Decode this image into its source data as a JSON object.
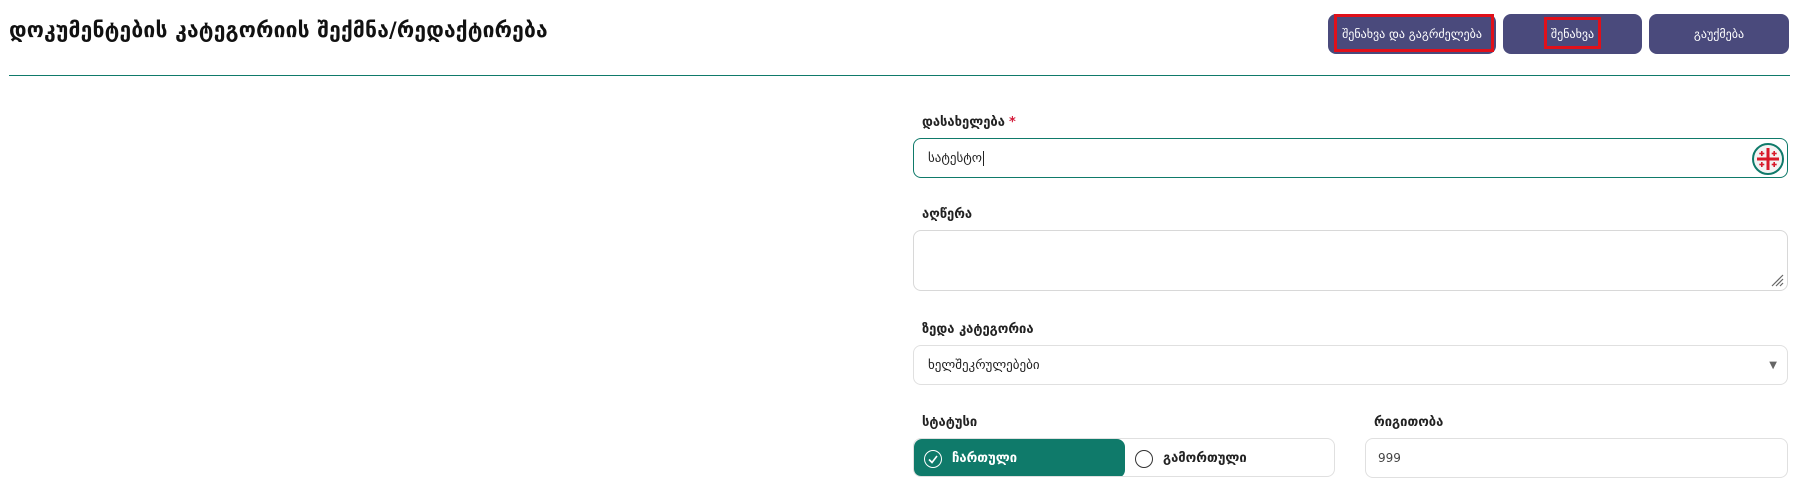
{
  "header": {
    "title": "დოკუმენტების კატეგორიის შექმნა/რედაქტირება",
    "buttons": {
      "save_continue": "შენახვა და გაგრძელება",
      "save": "შენახვა",
      "cancel": "გაუქმება"
    }
  },
  "form": {
    "name": {
      "label": "დასახელება",
      "required_mark": "*",
      "value": "სატესტო"
    },
    "description": {
      "label": "აღწერა",
      "value": ""
    },
    "parent_category": {
      "label": "ზედა კატეგორია",
      "selected": "ხელშეკრულებები"
    },
    "status": {
      "label": "სტატუსი",
      "options": [
        "ჩართული",
        "გამორთული"
      ],
      "selected": "ჩართული"
    },
    "order": {
      "label": "რიგითობა",
      "value": "999"
    }
  },
  "colors": {
    "accent": "#0f7a6a",
    "button": "#4a4a7c",
    "highlight": "#e0101a",
    "required": "#d41a3a"
  },
  "icons": {
    "input_addon": "georgian-cross-icon",
    "select": "caret-down-icon",
    "status_on": "check-circle-icon",
    "status_off": "radio-empty-icon"
  }
}
